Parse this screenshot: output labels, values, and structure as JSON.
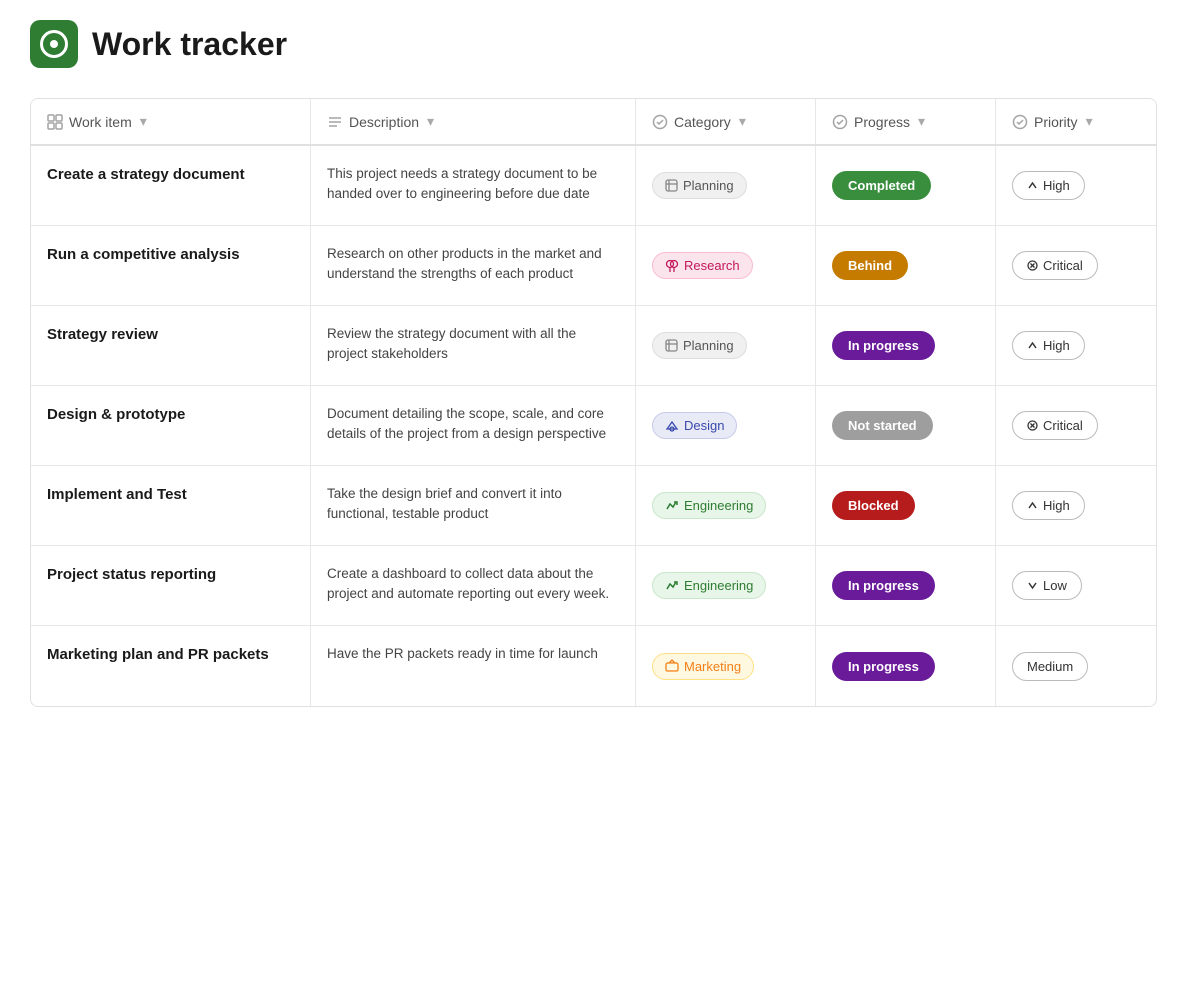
{
  "app": {
    "title": "Work tracker",
    "logo_alt": "Work tracker logo"
  },
  "columns": [
    {
      "id": "work-item",
      "label": "Work item",
      "icon": "table-icon"
    },
    {
      "id": "description",
      "label": "Description",
      "icon": "list-icon"
    },
    {
      "id": "category",
      "label": "Category",
      "icon": "check-circle-icon"
    },
    {
      "id": "progress",
      "label": "Progress",
      "icon": "check-circle-icon"
    },
    {
      "id": "priority",
      "label": "Priority",
      "icon": "check-circle-icon"
    }
  ],
  "rows": [
    {
      "work_item": "Create a strategy document",
      "description": "This project needs a strategy document to be handed over to engineering before due date",
      "category": {
        "label": "Planning",
        "type": "planning"
      },
      "progress": {
        "label": "Completed",
        "type": "completed"
      },
      "priority": {
        "label": "High",
        "direction": "up"
      }
    },
    {
      "work_item": "Run a competitive analysis",
      "description": "Research on other products in the market and understand the strengths of each product",
      "category": {
        "label": "Research",
        "type": "research"
      },
      "progress": {
        "label": "Behind",
        "type": "behind"
      },
      "priority": {
        "label": "Critical",
        "direction": "x"
      }
    },
    {
      "work_item": "Strategy review",
      "description": "Review the strategy document with all the project stakeholders",
      "category": {
        "label": "Planning",
        "type": "planning"
      },
      "progress": {
        "label": "In progress",
        "type": "in-progress"
      },
      "priority": {
        "label": "High",
        "direction": "up"
      }
    },
    {
      "work_item": "Design & prototype",
      "description": "Document detailing the scope, scale, and core details of the project from a design perspective",
      "category": {
        "label": "Design",
        "type": "design"
      },
      "progress": {
        "label": "Not started",
        "type": "not-started"
      },
      "priority": {
        "label": "Critical",
        "direction": "x"
      }
    },
    {
      "work_item": "Implement and Test",
      "description": "Take the design brief and convert it into functional, testable product",
      "category": {
        "label": "Engineering",
        "type": "engineering"
      },
      "progress": {
        "label": "Blocked",
        "type": "blocked"
      },
      "priority": {
        "label": "High",
        "direction": "up"
      }
    },
    {
      "work_item": "Project status reporting",
      "description": "Create a dashboard to collect data about the project and automate reporting out every week.",
      "category": {
        "label": "Engineering",
        "type": "engineering"
      },
      "progress": {
        "label": "In progress",
        "type": "in-progress"
      },
      "priority": {
        "label": "Low",
        "direction": "down"
      }
    },
    {
      "work_item": "Marketing plan and PR packets",
      "description": "Have the PR packets ready in time for launch",
      "category": {
        "label": "Marketing",
        "type": "marketing"
      },
      "progress": {
        "label": "In progress",
        "type": "in-progress"
      },
      "priority": {
        "label": "Medium",
        "direction": "none"
      }
    }
  ]
}
